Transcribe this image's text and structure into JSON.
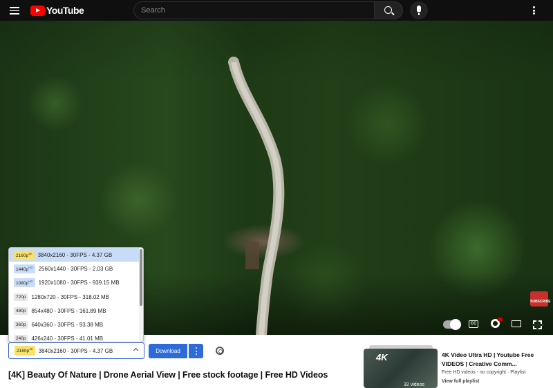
{
  "header": {
    "logo_text": "YouTube",
    "search_placeholder": "Search"
  },
  "player": {
    "watermark_text": "SUBSCRIBE",
    "controls": [
      "autoplay-toggle",
      "captions",
      "settings",
      "theater-mode",
      "fullscreen"
    ]
  },
  "quality_dropdown": {
    "options": [
      {
        "badge": "2160p",
        "badge_tag": "4K",
        "label": "3840x2160 - 30FPS - 4.37 GB",
        "selected": true
      },
      {
        "badge": "1440p",
        "badge_tag": "HD",
        "label": "2560x1440 - 30FPS - 2.03 GB"
      },
      {
        "badge": "1080p",
        "badge_tag": "HD",
        "label": "1920x1080 - 30FPS - 939.15 MB"
      },
      {
        "badge": "720p",
        "badge_tag": "",
        "label": "1280x720 - 30FPS - 318.02 MB"
      },
      {
        "badge": "480p",
        "badge_tag": "",
        "label": "854x480 - 30FPS - 161.89 MB"
      },
      {
        "badge": "360p",
        "badge_tag": "",
        "label": "640x360 - 30FPS - 93.38 MB"
      },
      {
        "badge": "240p",
        "badge_tag": "",
        "label": "426x240 - 30FPS - 41.01 MB"
      }
    ]
  },
  "download_bar": {
    "selected_badge": "2160p",
    "selected_badge_tag": "4K",
    "selected_label": "3840x2160 - 30FPS - 4.37 GB",
    "download_label": "Download"
  },
  "video": {
    "title": "[4K] Beauty Of Nature | Drone Aerial View | Free stock footage | Free HD Videos"
  },
  "playlist": {
    "thumb_label": "4K",
    "video_count": "32 videos",
    "title": "4K Video Ultra HD | Youtube Free VIDEOS | Creative Comm...",
    "meta": "Free HD videos - no copyright · Playlist",
    "link": "View full playlist"
  }
}
